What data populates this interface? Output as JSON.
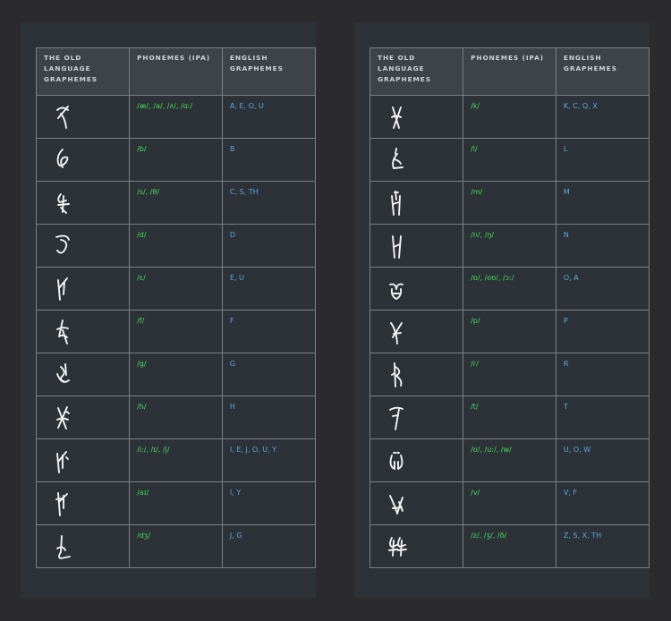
{
  "headers": {
    "col1": "THE OLD LANGUAGE GRAPHEMES",
    "col2": "PHONEMES (IPA)",
    "col3": "ENGLISH GRAPHEMES"
  },
  "colors": {
    "background": "#2b2b2d",
    "panel": "#2c3237",
    "header_bg": "#3c4349",
    "grid": "#7b8186",
    "ipa_text": "#43e05a",
    "english_text": "#56a9e6",
    "glyph": "#f2f2f2"
  },
  "tables": [
    {
      "rows": [
        {
          "glyph": "rune-a-icon",
          "ipa": "/æ/, /a/, /ʌ/, /ɑː/",
          "english": "A, E, O, U"
        },
        {
          "glyph": "rune-b-icon",
          "ipa": "/b/",
          "english": "B"
        },
        {
          "glyph": "rune-s-icon",
          "ipa": "/s/, /θ/",
          "english": "C, S, TH"
        },
        {
          "glyph": "rune-d-icon",
          "ipa": "/d/",
          "english": "D"
        },
        {
          "glyph": "rune-e-icon",
          "ipa": "/ɛ/",
          "english": "E, U"
        },
        {
          "glyph": "rune-f-icon",
          "ipa": "/f/",
          "english": "F"
        },
        {
          "glyph": "rune-g-icon",
          "ipa": "/g/",
          "english": "G"
        },
        {
          "glyph": "rune-h-icon",
          "ipa": "/h/",
          "english": "H"
        },
        {
          "glyph": "rune-i-icon",
          "ipa": "/iː/, /ɪ/, /j/",
          "english": "I, E, J, O, U, Y"
        },
        {
          "glyph": "rune-ai-icon",
          "ipa": "/aɪ/",
          "english": "I, Y"
        },
        {
          "glyph": "rune-j-icon",
          "ipa": "/dʒ/",
          "english": "J, G"
        }
      ]
    },
    {
      "rows": [
        {
          "glyph": "rune-k-icon",
          "ipa": "/k/",
          "english": "K, C, Q, X"
        },
        {
          "glyph": "rune-l-icon",
          "ipa": "/l/",
          "english": "L"
        },
        {
          "glyph": "rune-m-icon",
          "ipa": "/m/",
          "english": "M"
        },
        {
          "glyph": "rune-n-icon",
          "ipa": "/n/, /ŋ/",
          "english": "N"
        },
        {
          "glyph": "rune-o-icon",
          "ipa": "/ɒ/, /oʊ/, /ɔː/",
          "english": "O, A"
        },
        {
          "glyph": "rune-p-icon",
          "ipa": "/p/",
          "english": "P"
        },
        {
          "glyph": "rune-r-icon",
          "ipa": "/r/",
          "english": "R"
        },
        {
          "glyph": "rune-t-icon",
          "ipa": "/t/",
          "english": "T"
        },
        {
          "glyph": "rune-u-icon",
          "ipa": "/ʊ/, /uː/, /w/",
          "english": "U, O, W"
        },
        {
          "glyph": "rune-v-icon",
          "ipa": "/v/",
          "english": "V, F"
        },
        {
          "glyph": "rune-z-icon",
          "ipa": "/z/, /ʒ/, /ð/",
          "english": "Z, S, X, TH"
        }
      ]
    }
  ]
}
